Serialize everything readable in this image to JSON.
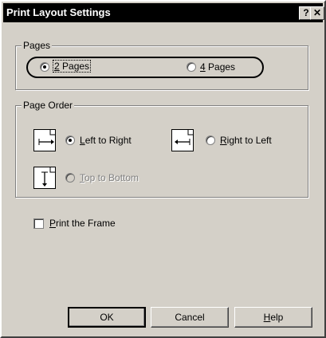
{
  "window": {
    "title": "Print Layout Settings",
    "help_button": "?",
    "close_button": "✕"
  },
  "pages_group": {
    "legend": "Pages",
    "options": [
      {
        "label_prefix": "",
        "mnemonic": "2",
        "label_rest": " Pages",
        "checked": true
      },
      {
        "label_prefix": "",
        "mnemonic": "4",
        "label_rest": " Pages",
        "checked": false
      }
    ]
  },
  "page_order_group": {
    "legend": "Page Order",
    "options": [
      {
        "mnemonic": "L",
        "label_rest": "eft to Right",
        "checked": true,
        "enabled": true
      },
      {
        "mnemonic": "R",
        "label_rest": "ight to Left",
        "checked": false,
        "enabled": true
      },
      {
        "mnemonic": "T",
        "label_rest": "op to Bottom",
        "checked": false,
        "enabled": false
      }
    ]
  },
  "print_frame": {
    "mnemonic": "P",
    "label_rest": "rint the Frame",
    "checked": false
  },
  "buttons": {
    "ok": "OK",
    "cancel": "Cancel",
    "help_mnemonic": "H",
    "help_rest": "elp"
  }
}
